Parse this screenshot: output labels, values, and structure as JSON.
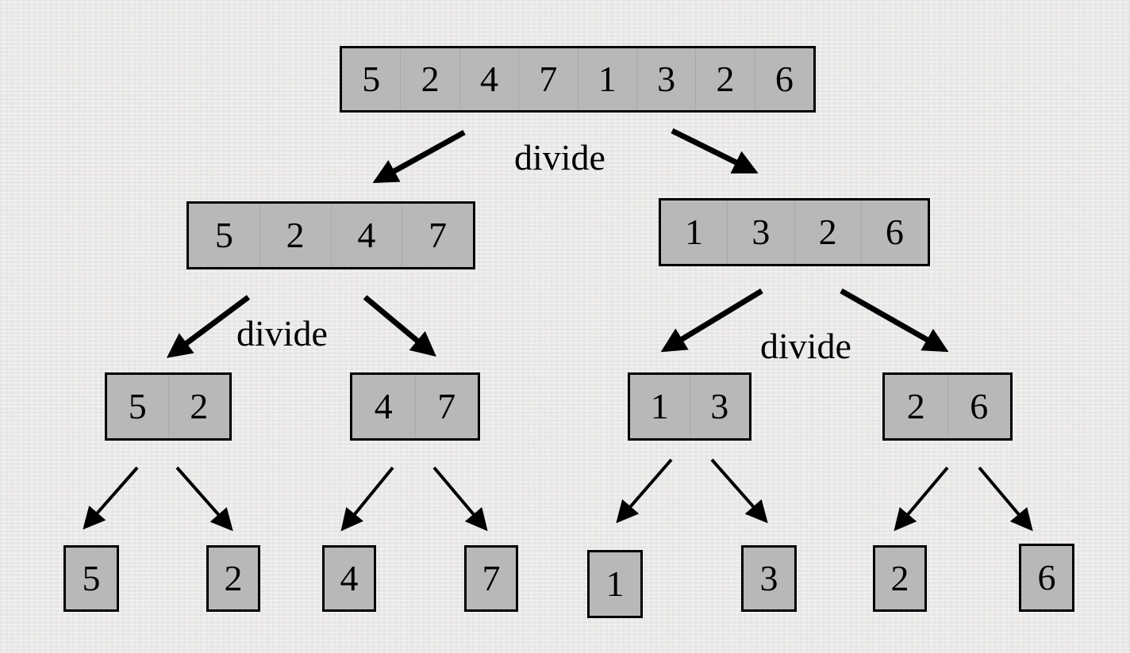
{
  "divide_labels": [
    "divide",
    "divide",
    "divide"
  ],
  "levels": [
    [
      [
        "5",
        "2",
        "4",
        "7",
        "1",
        "3",
        "2",
        "6"
      ]
    ],
    [
      [
        "5",
        "2",
        "4",
        "7"
      ],
      [
        "1",
        "3",
        "2",
        "6"
      ]
    ],
    [
      [
        "5",
        "2"
      ],
      [
        "4",
        "7"
      ],
      [
        "1",
        "3"
      ],
      [
        "2",
        "6"
      ]
    ],
    [
      [
        "5"
      ],
      [
        "2"
      ],
      [
        "4"
      ],
      [
        "7"
      ],
      [
        "1"
      ],
      [
        "3"
      ],
      [
        "2"
      ],
      [
        "6"
      ]
    ]
  ],
  "colors": {
    "box_fill": "#b8b8b8",
    "box_border": "#000000",
    "arrow": "#000000",
    "background": "#eeecea"
  }
}
